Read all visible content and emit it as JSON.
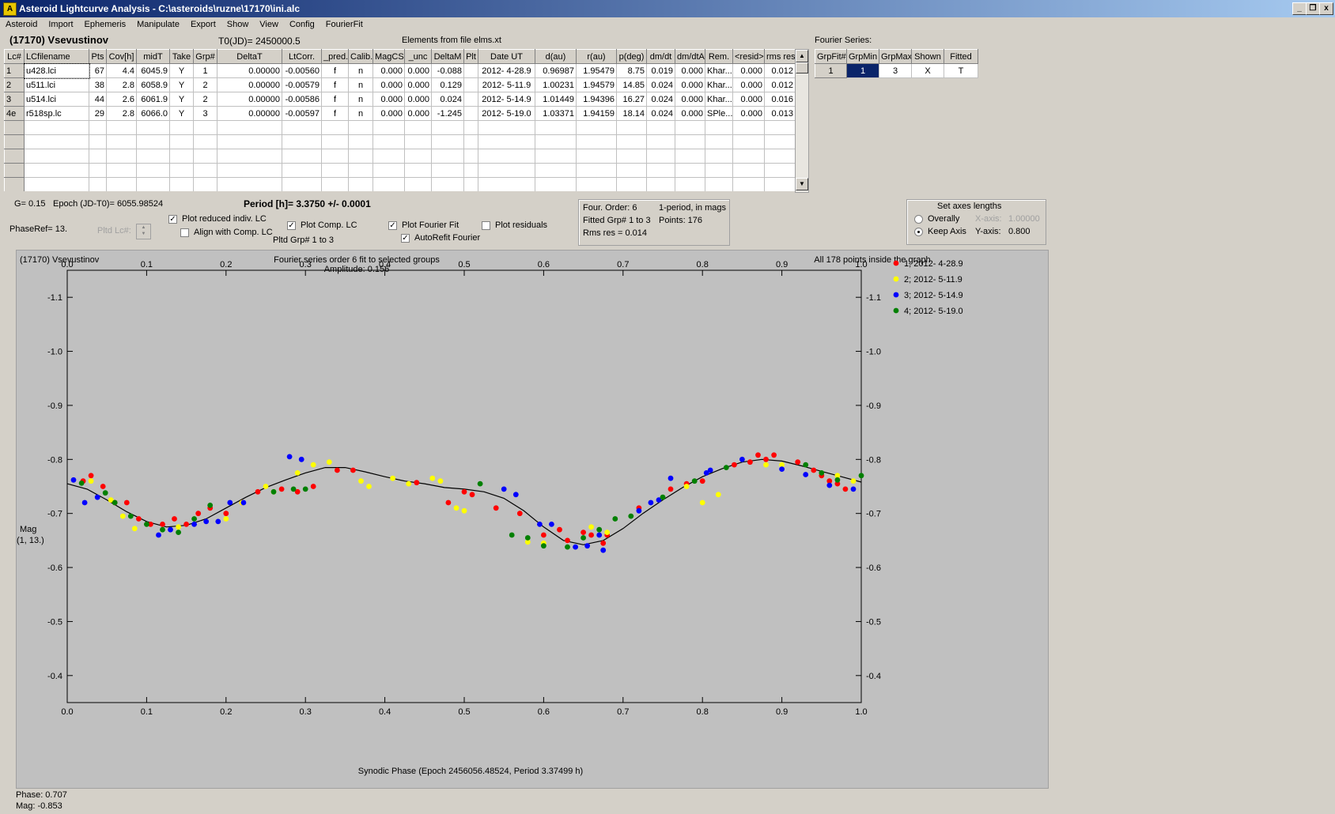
{
  "window": {
    "title": "Asteroid Lightcurve Analysis - C:\\asteroids\\ruzne\\17170\\ini.alc",
    "icon_letter": "A",
    "btn_min": "_",
    "btn_restore": "❐",
    "btn_close": "x"
  },
  "menu": [
    "Asteroid",
    "Import",
    "Ephemeris",
    "Manipulate",
    "Export",
    "Show",
    "View",
    "Config",
    "FourierFit"
  ],
  "header": {
    "asteroid": "(17170) Vsevustinov",
    "t0": "T0(JD)= 2450000.5",
    "elements": "Elements from file elms.xt"
  },
  "lc_table": {
    "columns": [
      "Lc#",
      "LCfilename",
      "Pts",
      "Cov[h]",
      "midT",
      "Take",
      "Grp#",
      "DeltaT",
      "LtCorr.",
      "_pred.",
      "Calib.",
      "MagCS",
      "_unc",
      "DeltaM",
      "Plt",
      "Date UT",
      "d(au)",
      "r(au)",
      "p(deg)",
      "dm/dt",
      "dm/dtA",
      "Rem.",
      "<resid>",
      "rms res"
    ],
    "rows": [
      [
        "1",
        "u428.lci",
        "67",
        "4.4",
        "6045.9",
        "Y",
        "1",
        "0.00000",
        "-0.00560",
        "f",
        "n",
        "0.000",
        "0.000",
        "-0.088",
        "",
        "2012- 4-28.9",
        "0.96987",
        "1.95479",
        "8.75",
        "0.019",
        "0.000",
        "Khar...",
        "0.000",
        "0.012"
      ],
      [
        "2",
        "u511.lci",
        "38",
        "2.8",
        "6058.9",
        "Y",
        "2",
        "0.00000",
        "-0.00579",
        "f",
        "n",
        "0.000",
        "0.000",
        "0.129",
        "",
        "2012- 5-11.9",
        "1.00231",
        "1.94579",
        "14.85",
        "0.024",
        "0.000",
        "Khar...",
        "0.000",
        "0.012"
      ],
      [
        "3",
        "u514.lci",
        "44",
        "2.6",
        "6061.9",
        "Y",
        "2",
        "0.00000",
        "-0.00586",
        "f",
        "n",
        "0.000",
        "0.000",
        "0.024",
        "",
        "2012- 5-14.9",
        "1.01449",
        "1.94396",
        "16.27",
        "0.024",
        "0.000",
        "Khar...",
        "0.000",
        "0.016"
      ],
      [
        "4e",
        "r518sp.lc",
        "29",
        "2.8",
        "6066.0",
        "Y",
        "3",
        "0.00000",
        "-0.00597",
        "f",
        "n",
        "0.000",
        "0.000",
        "-1.245",
        "",
        "2012- 5-19.0",
        "1.03371",
        "1.94159",
        "18.14",
        "0.024",
        "0.000",
        "SPle...",
        "0.000",
        "0.013"
      ]
    ],
    "empty_rows": 5
  },
  "fourier_series": {
    "label": "Fourier Series:",
    "columns": [
      "GrpFit#",
      "GrpMin",
      "GrpMax",
      "Shown",
      "Fitted"
    ],
    "row": [
      "1",
      "1",
      "3",
      "X",
      "T"
    ]
  },
  "controls": {
    "g": "G= 0.15",
    "epoch": "Epoch (JD-T0)= 6055.98524",
    "period": "Period [h]= 3.3750 +/- 0.0001",
    "phaseref": "PhaseRef= 13.",
    "pltd_lc": "Pltd Lc#:",
    "plot_reduced": "Plot reduced indiv. LC",
    "align_comp": "Align with Comp. LC",
    "plot_comp": "Plot Comp. LC",
    "pltd_grp": "Pltd Grp#  1  to  3",
    "plot_fourier": "Plot Fourier Fit",
    "autorefit": "AutoRefit Fourier",
    "plot_residuals": "Plot residuals",
    "checks": {
      "plot_reduced": true,
      "align_comp": false,
      "plot_comp": true,
      "plot_fourier": true,
      "autorefit": true,
      "plot_residuals": false
    }
  },
  "fit_info": {
    "order": "Four. Order:  6",
    "period_mode": "1-period, in mags",
    "fitted": "Fitted Grp# 1 to 3",
    "points": "Points: 176",
    "rms": "Rms res    = 0.014"
  },
  "axes_box": {
    "title": "Set axes lengths",
    "overally": "Overally",
    "keep_axis": "Keep Axis",
    "xaxis_label": "X-axis:",
    "xaxis_value": "1.00000",
    "yaxis_label": "Y-axis:",
    "yaxis_value": "0.800",
    "selected": "Keep Axis"
  },
  "plot": {
    "asteroid": "(17170) Vsevustinov",
    "subtitle1": "Fourier series order 6 fit to selected groups",
    "subtitle2": "Amplitude: 0.156",
    "points_note": "All 178 points inside the graph",
    "ylabel1": "Mag",
    "ylabel2": "(1, 13.)",
    "xlabel": "Synodic Phase (Epoch 2456056.48524, Period 3.37499 h)"
  },
  "status": {
    "phase": "Phase:  0.707",
    "mag": "Mag:    -0.853"
  },
  "chart_data": {
    "type": "scatter",
    "xlim": [
      0.0,
      1.0
    ],
    "ylim": [
      -1.15,
      -0.35
    ],
    "y_inverted": true,
    "x_ticks": [
      0.0,
      0.1,
      0.2,
      0.3,
      0.4,
      0.5,
      0.6,
      0.7,
      0.8,
      0.9,
      1.0
    ],
    "y_ticks": [
      -1.1,
      -1.0,
      -0.9,
      -0.8,
      -0.7,
      -0.6,
      -0.5,
      -0.4
    ],
    "series": [
      {
        "name": "1; 2012- 4-28.9",
        "color": "#ff0000",
        "points": [
          [
            0.02,
            -0.76
          ],
          [
            0.03,
            -0.77
          ],
          [
            0.045,
            -0.75
          ],
          [
            0.06,
            -0.72
          ],
          [
            0.075,
            -0.72
          ],
          [
            0.09,
            -0.69
          ],
          [
            0.105,
            -0.68
          ],
          [
            0.12,
            -0.68
          ],
          [
            0.135,
            -0.69
          ],
          [
            0.15,
            -0.68
          ],
          [
            0.165,
            -0.7
          ],
          [
            0.18,
            -0.71
          ],
          [
            0.2,
            -0.7
          ],
          [
            0.22,
            -0.72
          ],
          [
            0.24,
            -0.74
          ],
          [
            0.27,
            -0.745
          ],
          [
            0.29,
            -0.74
          ],
          [
            0.31,
            -0.75
          ],
          [
            0.34,
            -0.78
          ],
          [
            0.36,
            -0.78
          ],
          [
            0.44,
            -0.757
          ],
          [
            0.48,
            -0.72
          ],
          [
            0.5,
            -0.74
          ],
          [
            0.51,
            -0.735
          ],
          [
            0.54,
            -0.71
          ],
          [
            0.57,
            -0.7
          ],
          [
            0.6,
            -0.66
          ],
          [
            0.62,
            -0.67
          ],
          [
            0.63,
            -0.65
          ],
          [
            0.65,
            -0.665
          ],
          [
            0.66,
            -0.66
          ],
          [
            0.675,
            -0.645
          ],
          [
            0.68,
            -0.66
          ],
          [
            0.72,
            -0.71
          ],
          [
            0.76,
            -0.745
          ],
          [
            0.78,
            -0.755
          ],
          [
            0.8,
            -0.76
          ],
          [
            0.84,
            -0.79
          ],
          [
            0.86,
            -0.795
          ],
          [
            0.87,
            -0.808
          ],
          [
            0.88,
            -0.8
          ],
          [
            0.89,
            -0.808
          ],
          [
            0.92,
            -0.795
          ],
          [
            0.94,
            -0.78
          ],
          [
            0.95,
            -0.77
          ],
          [
            0.96,
            -0.76
          ],
          [
            0.97,
            -0.755
          ],
          [
            0.98,
            -0.745
          ]
        ]
      },
      {
        "name": "2; 2012- 5-11.9",
        "color": "#ffff00",
        "points": [
          [
            0.03,
            -0.76
          ],
          [
            0.055,
            -0.725
          ],
          [
            0.07,
            -0.695
          ],
          [
            0.085,
            -0.672
          ],
          [
            0.14,
            -0.675
          ],
          [
            0.2,
            -0.69
          ],
          [
            0.22,
            -0.72
          ],
          [
            0.25,
            -0.75
          ],
          [
            0.26,
            -0.74
          ],
          [
            0.29,
            -0.775
          ],
          [
            0.31,
            -0.79
          ],
          [
            0.33,
            -0.795
          ],
          [
            0.37,
            -0.76
          ],
          [
            0.38,
            -0.75
          ],
          [
            0.41,
            -0.765
          ],
          [
            0.43,
            -0.755
          ],
          [
            0.46,
            -0.765
          ],
          [
            0.47,
            -0.76
          ],
          [
            0.49,
            -0.71
          ],
          [
            0.5,
            -0.705
          ],
          [
            0.58,
            -0.647
          ],
          [
            0.6,
            -0.645
          ],
          [
            0.66,
            -0.675
          ],
          [
            0.68,
            -0.665
          ],
          [
            0.78,
            -0.75
          ],
          [
            0.8,
            -0.72
          ],
          [
            0.82,
            -0.735
          ],
          [
            0.88,
            -0.79
          ],
          [
            0.9,
            -0.79
          ],
          [
            0.97,
            -0.77
          ],
          [
            0.99,
            -0.76
          ]
        ]
      },
      {
        "name": "3; 2012- 5-14.9",
        "color": "#0000ff",
        "points": [
          [
            0.008,
            -0.762
          ],
          [
            0.022,
            -0.72
          ],
          [
            0.038,
            -0.73
          ],
          [
            0.115,
            -0.66
          ],
          [
            0.13,
            -0.67
          ],
          [
            0.16,
            -0.68
          ],
          [
            0.175,
            -0.685
          ],
          [
            0.19,
            -0.685
          ],
          [
            0.205,
            -0.72
          ],
          [
            0.222,
            -0.72
          ],
          [
            0.28,
            -0.805
          ],
          [
            0.295,
            -0.8
          ],
          [
            0.55,
            -0.745
          ],
          [
            0.565,
            -0.735
          ],
          [
            0.595,
            -0.68
          ],
          [
            0.61,
            -0.68
          ],
          [
            0.64,
            -0.638
          ],
          [
            0.655,
            -0.64
          ],
          [
            0.67,
            -0.66
          ],
          [
            0.675,
            -0.632
          ],
          [
            0.72,
            -0.705
          ],
          [
            0.735,
            -0.72
          ],
          [
            0.745,
            -0.725
          ],
          [
            0.76,
            -0.765
          ],
          [
            0.805,
            -0.775
          ],
          [
            0.81,
            -0.78
          ],
          [
            0.85,
            -0.8
          ],
          [
            0.9,
            -0.782
          ],
          [
            0.93,
            -0.772
          ],
          [
            0.96,
            -0.752
          ],
          [
            0.99,
            -0.745
          ]
        ]
      },
      {
        "name": "4; 2012- 5-19.0",
        "color": "#008000",
        "points": [
          [
            0.018,
            -0.756
          ],
          [
            0.048,
            -0.738
          ],
          [
            0.06,
            -0.72
          ],
          [
            0.08,
            -0.695
          ],
          [
            0.1,
            -0.68
          ],
          [
            0.12,
            -0.67
          ],
          [
            0.14,
            -0.665
          ],
          [
            0.16,
            -0.69
          ],
          [
            0.18,
            -0.715
          ],
          [
            0.26,
            -0.74
          ],
          [
            0.285,
            -0.745
          ],
          [
            0.3,
            -0.745
          ],
          [
            0.52,
            -0.755
          ],
          [
            0.56,
            -0.66
          ],
          [
            0.58,
            -0.655
          ],
          [
            0.6,
            -0.64
          ],
          [
            0.63,
            -0.638
          ],
          [
            0.65,
            -0.655
          ],
          [
            0.67,
            -0.67
          ],
          [
            0.69,
            -0.69
          ],
          [
            0.71,
            -0.695
          ],
          [
            0.75,
            -0.73
          ],
          [
            0.79,
            -0.76
          ],
          [
            0.83,
            -0.785
          ],
          [
            0.93,
            -0.79
          ],
          [
            0.95,
            -0.775
          ],
          [
            0.97,
            -0.762
          ],
          [
            1.0,
            -0.77
          ]
        ]
      }
    ],
    "fit_curve": [
      [
        0.0,
        -0.755
      ],
      [
        0.025,
        -0.745
      ],
      [
        0.05,
        -0.725
      ],
      [
        0.075,
        -0.703
      ],
      [
        0.1,
        -0.685
      ],
      [
        0.125,
        -0.675
      ],
      [
        0.15,
        -0.678
      ],
      [
        0.175,
        -0.69
      ],
      [
        0.2,
        -0.71
      ],
      [
        0.225,
        -0.73
      ],
      [
        0.25,
        -0.748
      ],
      [
        0.275,
        -0.762
      ],
      [
        0.3,
        -0.775
      ],
      [
        0.325,
        -0.785
      ],
      [
        0.35,
        -0.785
      ],
      [
        0.375,
        -0.777
      ],
      [
        0.4,
        -0.768
      ],
      [
        0.425,
        -0.76
      ],
      [
        0.45,
        -0.755
      ],
      [
        0.475,
        -0.748
      ],
      [
        0.5,
        -0.745
      ],
      [
        0.525,
        -0.74
      ],
      [
        0.55,
        -0.728
      ],
      [
        0.575,
        -0.705
      ],
      [
        0.6,
        -0.675
      ],
      [
        0.625,
        -0.65
      ],
      [
        0.65,
        -0.642
      ],
      [
        0.675,
        -0.65
      ],
      [
        0.7,
        -0.672
      ],
      [
        0.725,
        -0.7
      ],
      [
        0.75,
        -0.725
      ],
      [
        0.775,
        -0.748
      ],
      [
        0.8,
        -0.768
      ],
      [
        0.825,
        -0.783
      ],
      [
        0.85,
        -0.795
      ],
      [
        0.875,
        -0.8
      ],
      [
        0.9,
        -0.797
      ],
      [
        0.925,
        -0.788
      ],
      [
        0.95,
        -0.778
      ],
      [
        0.975,
        -0.768
      ],
      [
        1.0,
        -0.758
      ]
    ]
  }
}
